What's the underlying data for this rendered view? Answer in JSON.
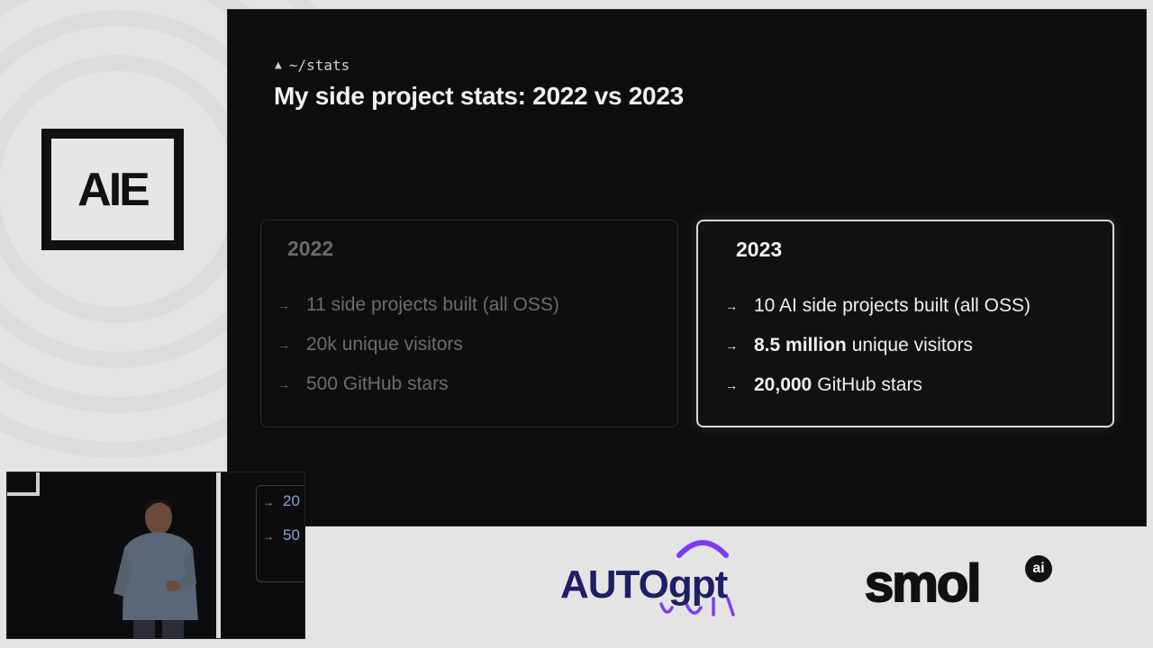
{
  "brand": {
    "conference_logo": "AIE"
  },
  "slide": {
    "breadcrumb_icon": "triangle-icon",
    "breadcrumb": "~/stats",
    "title": "My side project stats: 2022 vs 2023",
    "cards": [
      {
        "year": "2022",
        "items": [
          {
            "bold": "",
            "text": "11 side projects built (all OSS)"
          },
          {
            "bold": "",
            "text": "20k unique visitors"
          },
          {
            "bold": "",
            "text": "500 GitHub stars"
          }
        ]
      },
      {
        "year": "2023",
        "items": [
          {
            "bold": "",
            "text": "10 AI side projects built (all OSS)"
          },
          {
            "bold": "8.5 million",
            "text": "unique visitors"
          },
          {
            "bold": "20,000",
            "text": "GitHub stars"
          }
        ]
      }
    ],
    "arrow": "→"
  },
  "video": {
    "partial_lines": [
      "20",
      "50"
    ]
  },
  "sponsors": {
    "autogpt": "AUTOgpt",
    "smol": "smol",
    "smol_badge": "ai"
  },
  "colors": {
    "slide_bg": "#0e0d0d",
    "dim_text": "#6d6d6d",
    "bright_text": "#f0f0f0",
    "autogpt_navy": "#1e1e66",
    "autogpt_purple": "#7a3cf0"
  }
}
